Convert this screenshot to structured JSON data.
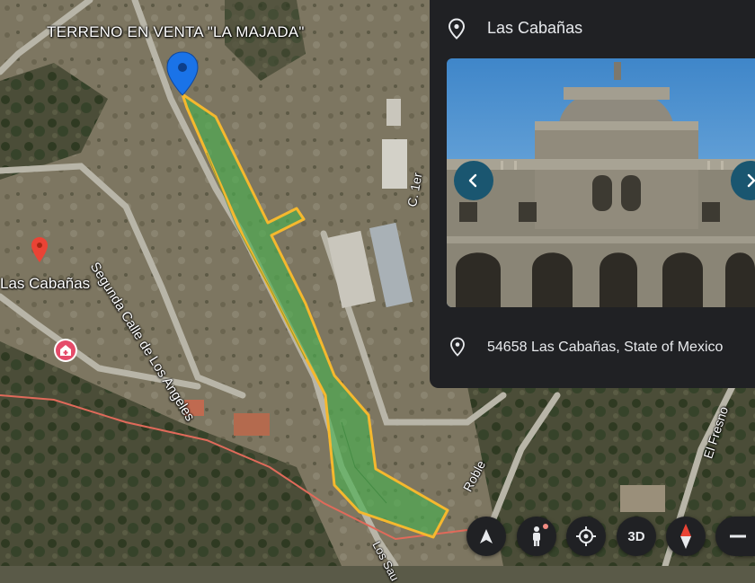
{
  "map": {
    "title_label": "TERRENO EN VENTA \"LA MAJADA\"",
    "place_label": "Las Cabañas",
    "streets": {
      "segunda": "Segunda Calle de Los Angeles",
      "cruz": "C. 1er",
      "roble": "Roble",
      "fresno": "El Fresno",
      "los_sauces": "Los Sau"
    },
    "colors": {
      "parcel_fill": "#4caf50",
      "parcel_outline": "#f5b82e",
      "pin_blue": "#1a73e8",
      "pin_red": "#ea4335",
      "route_line": "#e06a5a"
    }
  },
  "card": {
    "title": "Las Cabañas",
    "address": "54658 Las Cabañas, State of Mexico",
    "photo_alt": "historic stone building facade",
    "prev_icon": "chevron-left-icon",
    "next_icon": "chevron-right-icon"
  },
  "controls": {
    "three_d_label": "3D",
    "icons": [
      "navigation-arrow-icon",
      "pegman-icon",
      "my-location-icon",
      "compass-icon",
      "zoom-out-icon"
    ]
  }
}
